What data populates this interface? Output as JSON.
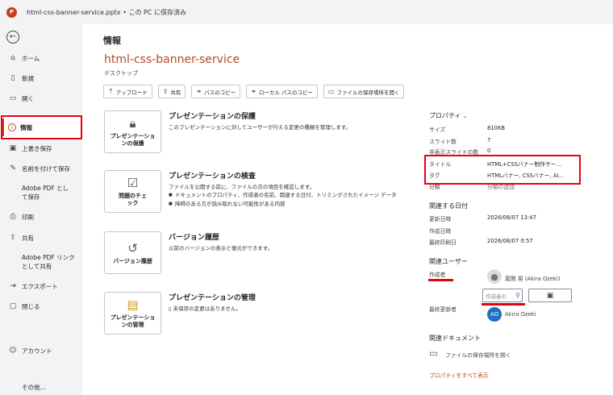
{
  "titlebar": {
    "app_icon": "P",
    "doc_title": "html-css-banner-service.pptx • この PC に保存済み"
  },
  "sidebar": {
    "back_icon": "←",
    "items": [
      {
        "label": "ホーム",
        "icon": "home-icon"
      },
      {
        "label": "新規",
        "icon": "new-doc-icon"
      },
      {
        "label": "開く",
        "icon": "folder-open-icon"
      },
      {
        "label": "情報",
        "icon": "info-icon",
        "active": true
      },
      {
        "label": "上書き保存",
        "icon": "save-icon"
      },
      {
        "label": "名前を付けて保存",
        "icon": "save-as-icon"
      },
      {
        "label": "Adobe PDF として保存",
        "icon": ""
      },
      {
        "label": "印刷",
        "icon": "print-icon"
      },
      {
        "label": "共有",
        "icon": "share-icon"
      },
      {
        "label": "Adobe PDF リンクとして共有",
        "icon": ""
      },
      {
        "label": "エクスポート",
        "icon": "export-icon"
      },
      {
        "label": "閉じる",
        "icon": "close-doc-icon"
      },
      {
        "label": "アカウント",
        "icon": "account-icon"
      },
      {
        "label": "その他...",
        "icon": ""
      }
    ]
  },
  "main": {
    "title": "情報",
    "file_name": "html-css-banner-service",
    "location": "デスクトップ",
    "toolbar": [
      {
        "label": "アップロード",
        "icon": "upload-icon"
      },
      {
        "label": "共有",
        "icon": "share-icon"
      },
      {
        "label": "パスのコピー",
        "icon": "link-icon"
      },
      {
        "label": "ローカル パスのコピー",
        "icon": "link-icon"
      },
      {
        "label": "ファイルの保存場所を開く",
        "icon": "folder-icon"
      }
    ],
    "sections": {
      "protect": {
        "button": "プレゼンテーションの保護",
        "heading": "プレゼンテーションの保護",
        "desc": "このプレゼンテーションに対してユーザーが行える変更の種類を管理します。"
      },
      "inspect": {
        "button": "問題のチェック",
        "heading": "プレゼンテーションの検査",
        "desc": "ファイルを公開する前に、ファイルの次の項目を確認します。",
        "bullets": [
          "ドキュメントのプロパティ、作成者の名前、関連する日付、トリミングされたイメージ データ",
          "障碍のある方が読み取れない可能性がある内容"
        ]
      },
      "history": {
        "button": "バージョン履歴",
        "heading": "バージョン履歴",
        "desc": "以前のバージョンの表示と復元ができます。"
      },
      "manage": {
        "button": "プレゼンテーションの管理",
        "heading": "プレゼンテーションの管理",
        "desc": "未保存の変更はありません。"
      }
    }
  },
  "properties": {
    "heading": "プロパティ",
    "rows": [
      {
        "label": "サイズ",
        "value": "810KB"
      },
      {
        "label": "スライド数",
        "value": "7"
      },
      {
        "label": "非表示スライドの数",
        "value": "0"
      },
      {
        "label": "タイトル",
        "value": "HTML+CSSバナー制作サー..."
      },
      {
        "label": "タグ",
        "value": "HTMLバナー, CSSバナー, AI..."
      },
      {
        "label": "分類",
        "value": "分類の追加"
      }
    ],
    "dates_heading": "関連する日付",
    "dates": [
      {
        "label": "更新日時",
        "value": "2026/08/07 13:47"
      },
      {
        "label": "作成日時",
        "value": ""
      },
      {
        "label": "最終印刷日",
        "value": "2026/08/07 0:57"
      }
    ],
    "people_heading": "関連ユーザー",
    "author_label": "作成者",
    "author_name": "尾関 晃 (Akira Ozeki)",
    "author_placeholder": "作成者の",
    "last_modified_label": "最終更新者",
    "last_modified_initials": "AO",
    "last_modified_name": "Akira Ozeki",
    "docs_heading": "関連ドキュメント",
    "open_location": "ファイルの保存場所を開く",
    "show_all": "プロパティをすべて表示"
  },
  "colors": {
    "accent": "#c43e1c",
    "highlight": "#e60012",
    "avatar_blue": "#1e6fc5"
  }
}
